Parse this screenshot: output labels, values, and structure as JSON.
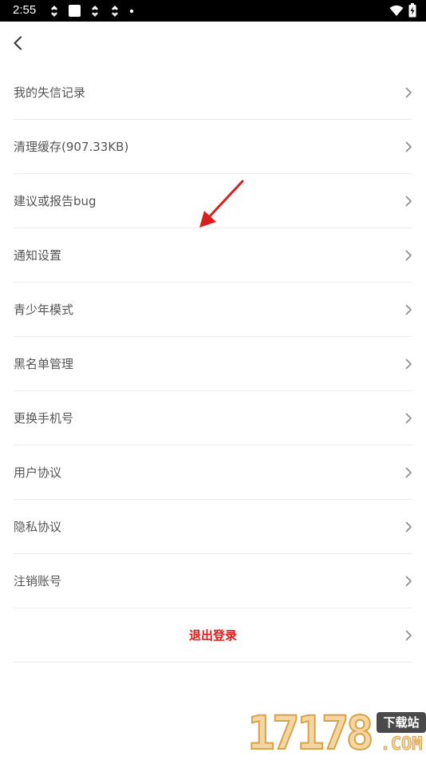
{
  "status_bar": {
    "time": "2:55"
  },
  "menu": {
    "items": [
      {
        "label": "我的失信记录"
      },
      {
        "label": "清理缓存(907.33KB)"
      },
      {
        "label": "建议或报告bug"
      },
      {
        "label": "通知设置"
      },
      {
        "label": "青少年模式"
      },
      {
        "label": "黑名单管理"
      },
      {
        "label": "更换手机号"
      },
      {
        "label": "用户协议"
      },
      {
        "label": "隐私协议"
      },
      {
        "label": "注销账号"
      }
    ],
    "logout_label": "退出登录"
  },
  "watermark": {
    "number": "17178",
    "badge": "下载站",
    "suffix": ".COM"
  },
  "colors": {
    "logout": "#e01b1b",
    "annotation_arrow": "#d62020",
    "divider": "#ececec"
  },
  "icons": {
    "back": "chevron-left-icon",
    "row": "chevron-right-icon"
  }
}
